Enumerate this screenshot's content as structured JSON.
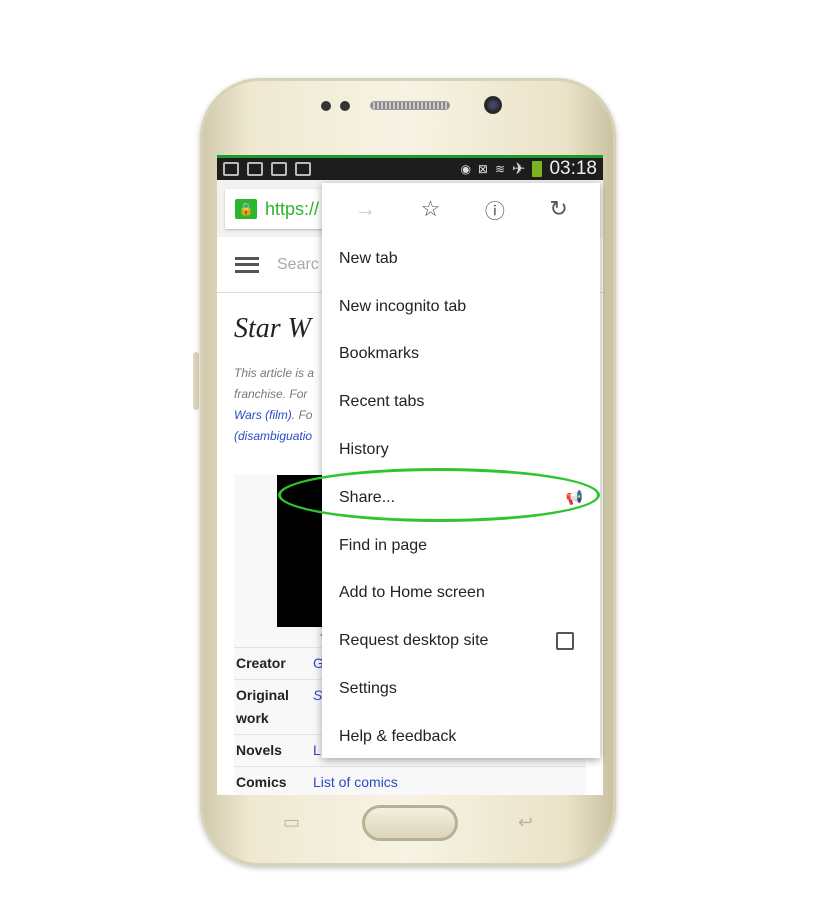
{
  "status_bar": {
    "time": "03:18",
    "icons": [
      "image-icon",
      "file-icon",
      "briefcase-icon",
      "video-icon",
      "eye-icon",
      "no-signal-icon",
      "wifi-icon",
      "airplane-icon",
      "battery-icon"
    ]
  },
  "url_bar": {
    "text": "https://"
  },
  "wiki": {
    "search_placeholder": "Searc",
    "title": "Star W",
    "note": [
      "This article is a",
      "franchise. For ",
      "Wars (film)",
      ". Fo",
      "(disambiguatio"
    ],
    "caption": "The S",
    "rows": [
      {
        "k": "Creator",
        "v": "G"
      },
      {
        "k": "Original work",
        "v": "S"
      },
      {
        "k": "Novels",
        "v": "L"
      },
      {
        "k": "Comics",
        "v": "List of comics"
      }
    ]
  },
  "menu": {
    "items": [
      "New tab",
      "New incognito tab",
      "Bookmarks",
      "Recent tabs",
      "History",
      "Share...",
      "Find in page",
      "Add to Home screen",
      "Request desktop site",
      "Settings",
      "Help & feedback"
    ]
  },
  "colors": {
    "accent": "#2ec52e",
    "link": "#2a4bc6"
  }
}
